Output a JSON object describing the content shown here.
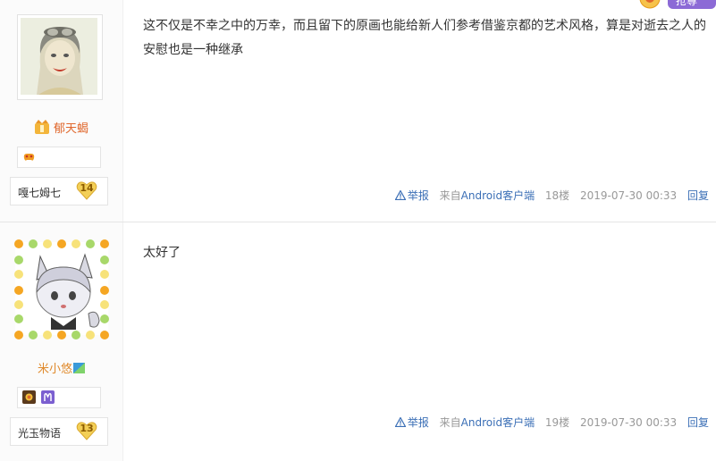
{
  "corner": {
    "button_text": "抢尊"
  },
  "posts": [
    {
      "username": "郁天蝎",
      "level_name": "嘎七姆七",
      "level_num": "14",
      "content": "这不仅是不幸之中的万幸，而且留下的原画也能给新人们参考借鉴京都的艺术风格，算是对逝去之人的安慰也是一种继承",
      "report": "举报",
      "client_prefix": "来自",
      "client_name": "Android客户端",
      "floor": "18楼",
      "time": "2019-07-30 00:33",
      "reply": "回复"
    },
    {
      "username": "米小悠",
      "level_name": "光玉物语",
      "level_num": "13",
      "content": "太好了",
      "report": "举报",
      "client_prefix": "来自",
      "client_name": "Android客户端",
      "floor": "19楼",
      "time": "2019-07-30 00:33",
      "reply": "回复"
    }
  ],
  "colors": {
    "link": "#3b6fb6",
    "username1": "#e0672c",
    "username2": "#e08a2c",
    "meta": "#999999"
  }
}
